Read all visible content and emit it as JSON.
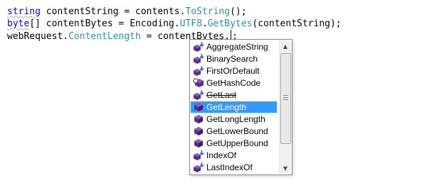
{
  "code": {
    "line1": {
      "keyword": "string",
      "plain1": " contentString = contents.",
      "method": "ToString",
      "plain2": "();"
    },
    "line2": {
      "keyword": "byte",
      "plain1": "[] contentBytes = Encoding.",
      "member1": "UTF8",
      "plain2": ".",
      "method": "GetBytes",
      "plain3": "(contentString);"
    },
    "line3": {
      "plain1": "webRequest.",
      "member": "ContentLength",
      "plain2": " = contentBytes.",
      "after_caret": ";"
    }
  },
  "completion": {
    "selected_index": 5,
    "items": [
      {
        "label": "AggregateString",
        "icon": "extension-method-icon"
      },
      {
        "label": "BinarySearch",
        "icon": "extension-method-icon"
      },
      {
        "label": "FirstOrDefault",
        "icon": "extension-method-icon"
      },
      {
        "label": "GetHashCode",
        "icon": "method-override-icon"
      },
      {
        "label": "GetLast",
        "icon": "extension-method-icon",
        "strike": true
      },
      {
        "label": "GetLength",
        "icon": "method-icon"
      },
      {
        "label": "GetLongLength",
        "icon": "method-icon"
      },
      {
        "label": "GetLowerBound",
        "icon": "method-icon"
      },
      {
        "label": "GetUpperBound",
        "icon": "method-icon"
      },
      {
        "label": "IndexOf",
        "icon": "extension-method-icon"
      },
      {
        "label": "LastIndexOf",
        "icon": "extension-method-icon"
      }
    ]
  },
  "colors": {
    "keyword": "#0000ff",
    "type_member": "#2b91af",
    "selection": "#3399ff"
  }
}
